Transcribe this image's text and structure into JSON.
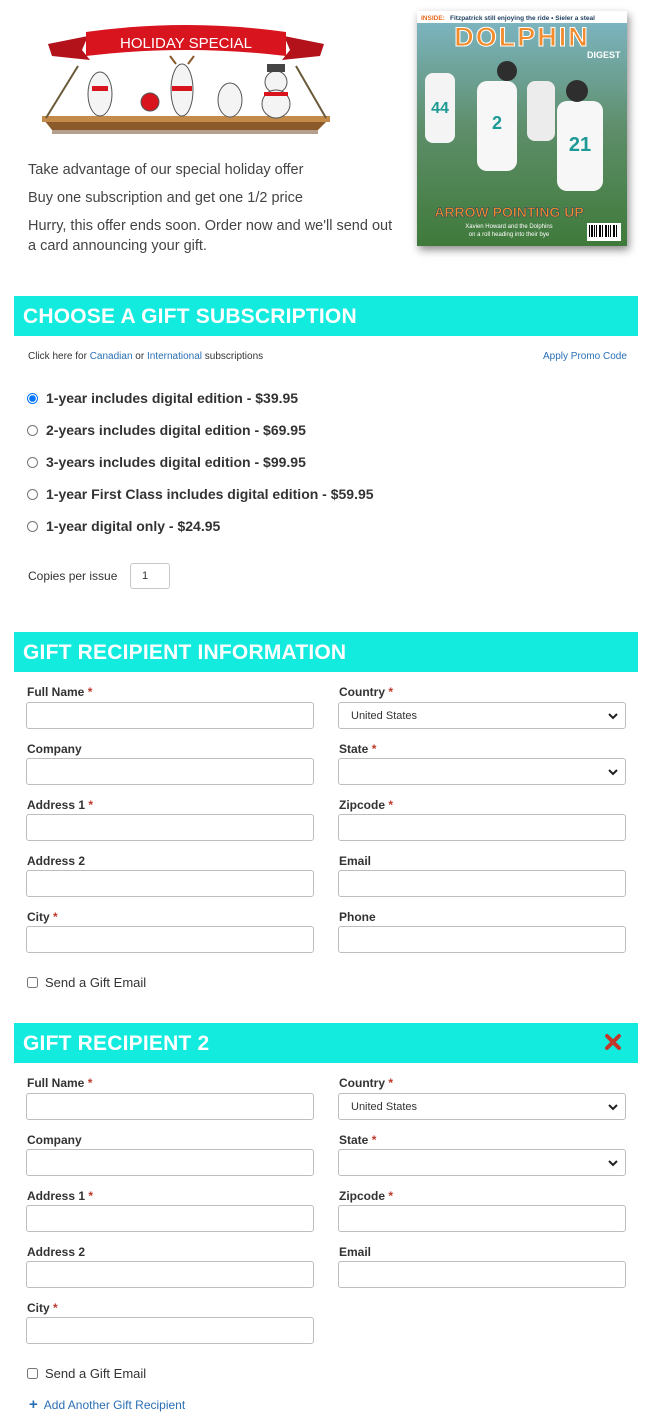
{
  "promo": {
    "banner_text": "HOLIDAY SPECIAL",
    "line1": "Take advantage of our special holiday offer",
    "line2": "Buy one subscription and get one 1/2 price",
    "line3": "Hurry, this offer ends soon. Order now and we'll send out a card announcing your gift."
  },
  "cover": {
    "inside_label": "INSIDE:",
    "inside_text": "Fitzpatrick still enjoying the ride • Sieler a steal",
    "masthead": "DOLPHIN",
    "masthead_sub": "DIGEST",
    "headline": "ARROW POINTING UP",
    "subline1": "Xavien Howard and the Dolphins",
    "subline2": "on a roll heading into their bye",
    "jersey1": "44",
    "jersey2": "2",
    "jersey3": "21"
  },
  "subscription": {
    "header": "CHOOSE A GIFT SUBSCRIPTION",
    "click_here": "Click here for",
    "canadian": "Canadian",
    "or": "or",
    "international": "International",
    "subscriptions": "subscriptions",
    "promo_code": "Apply Promo Code",
    "options": [
      {
        "label": "1-year includes digital edition - $39.95",
        "checked": true
      },
      {
        "label": "2-years includes digital edition - $69.95",
        "checked": false
      },
      {
        "label": "3-years includes digital edition - $99.95",
        "checked": false
      },
      {
        "label": "1-year First Class includes digital edition - $59.95",
        "checked": false
      },
      {
        "label": "1-year digital only - $24.95",
        "checked": false
      }
    ],
    "copies_label": "Copies per issue",
    "copies_value": "1"
  },
  "recipient1": {
    "header": "GIFT RECIPIENT INFORMATION",
    "full_name": "Full Name",
    "company": "Company",
    "address1": "Address 1",
    "address2": "Address 2",
    "city": "City",
    "country": "Country",
    "country_value": "United States",
    "state": "State",
    "state_value": "",
    "zipcode": "Zipcode",
    "email": "Email",
    "phone": "Phone",
    "send_email": "Send a Gift Email"
  },
  "recipient2": {
    "header": "GIFT RECIPIENT 2",
    "full_name": "Full Name",
    "company": "Company",
    "address1": "Address 1",
    "address2": "Address 2",
    "city": "City",
    "country": "Country",
    "country_value": "United States",
    "state": "State",
    "state_value": "",
    "zipcode": "Zipcode",
    "email": "Email",
    "send_email": "Send a Gift Email"
  },
  "required_mark": "*",
  "add_recipient": "Add Another Gift Recipient",
  "colors": {
    "section_header": "#13ebdf",
    "link": "#2a6fb5",
    "required": "#c0392b",
    "close_x": "#c0392b"
  }
}
